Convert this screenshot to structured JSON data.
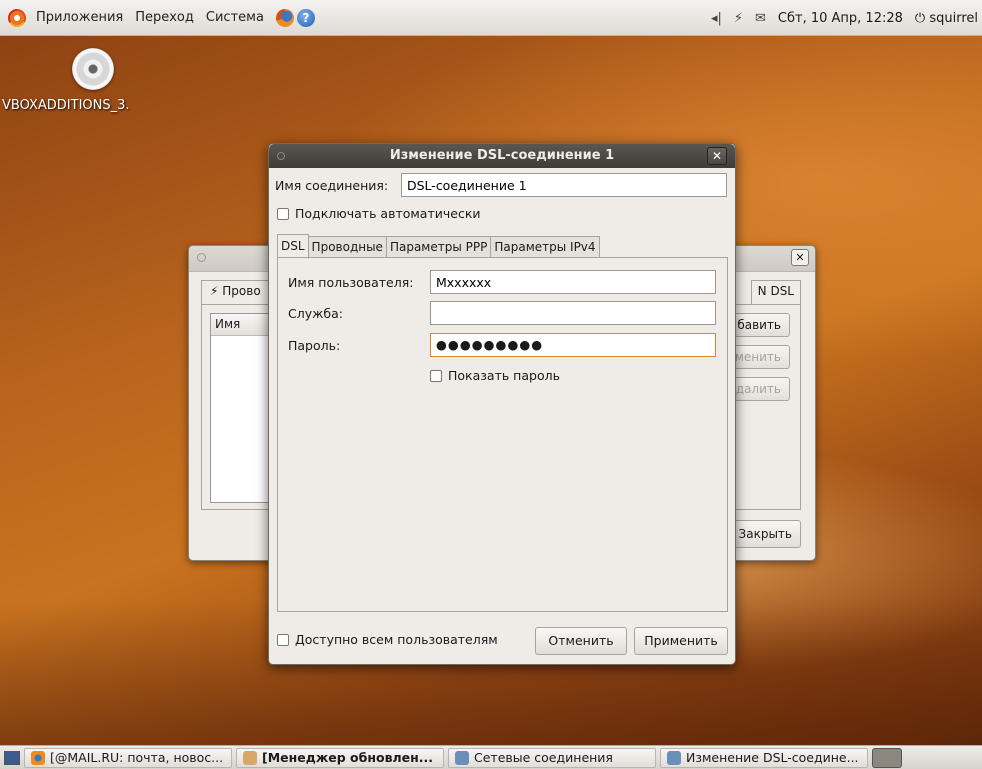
{
  "top_panel": {
    "menu": [
      "Приложения",
      "Переход",
      "Система"
    ],
    "clock": "Сбт, 10 Апр, 12:28",
    "user": "squirrel"
  },
  "desktop": {
    "icon_label": "VBOXADDITIONS_3."
  },
  "bg_window": {
    "tab_left": "Прово",
    "tab_right": "N  DSL",
    "list_header": "Имя",
    "btn_add": "бавить",
    "btn_edit": "менить",
    "btn_delete": "далить",
    "btn_close": "Закрыть"
  },
  "dialog": {
    "title": "Изменение DSL-соединение 1",
    "conn_name_label": "Имя соединения:",
    "conn_name_value": "DSL-соединение 1",
    "auto_connect_label": "Подключать автоматически",
    "tabs": [
      "DSL",
      "Проводные",
      "Параметры PPP",
      "Параметры IPv4"
    ],
    "username_label": "Имя пользователя:",
    "username_value": "Mxxxxxx",
    "service_label": "Служба:",
    "service_value": "",
    "password_label": "Пароль:",
    "password_value": "●●●●●●●●●",
    "show_password_label": "Показать пароль",
    "all_users_label": "Доступно всем пользователям",
    "cancel_label": "Отменить",
    "apply_label": "Применить"
  },
  "taskbar": {
    "items": [
      "[@MAIL.RU: почта, новос...",
      "[Менеджер обновлен...",
      "Сетевые соединения",
      "Изменение DSL-соедине..."
    ]
  }
}
